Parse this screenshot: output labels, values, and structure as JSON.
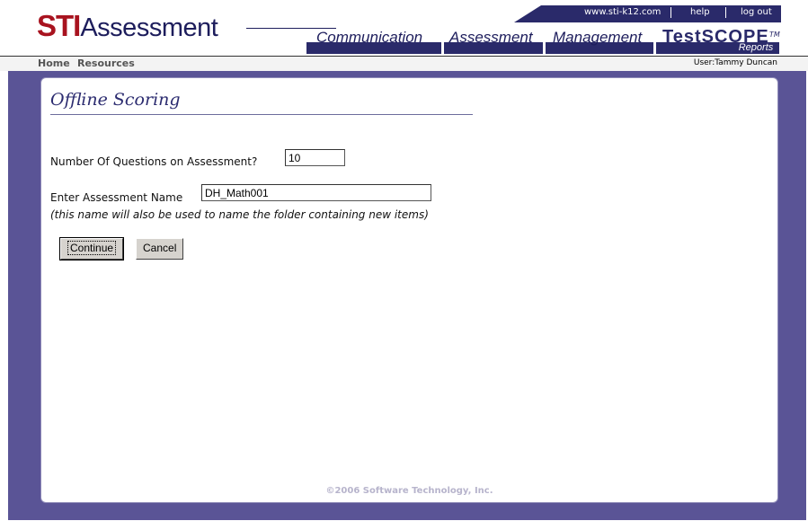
{
  "header": {
    "logo_sti": "STI",
    "logo_rest": "Assessment",
    "top_links": {
      "website": "www.sti-k12.com",
      "help": "help",
      "logout": "log out"
    },
    "nav": [
      "Communication",
      "Assessment",
      "Management"
    ],
    "testscope": {
      "brand": "TestSCOPE",
      "tm": "TM",
      "reports": "Reports"
    }
  },
  "subnav": {
    "home": "Home",
    "resources": "Resources",
    "user": "User:Tammy Duncan"
  },
  "page": {
    "title": "Offline Scoring",
    "questions_label": "Number Of Questions on Assessment?",
    "questions_value": "10",
    "name_label": "Enter Assessment Name",
    "name_value": "DH_Math001",
    "hint": "(this name will also be used to name the folder containing new items)",
    "continue_label": "Continue",
    "cancel_label": "Cancel"
  },
  "footer": {
    "copyright": "©2006 Software Technology, Inc."
  },
  "colors": {
    "brand_red": "#a8131f",
    "navy": "#2a2a6a",
    "frame_purple": "#5a5496"
  }
}
